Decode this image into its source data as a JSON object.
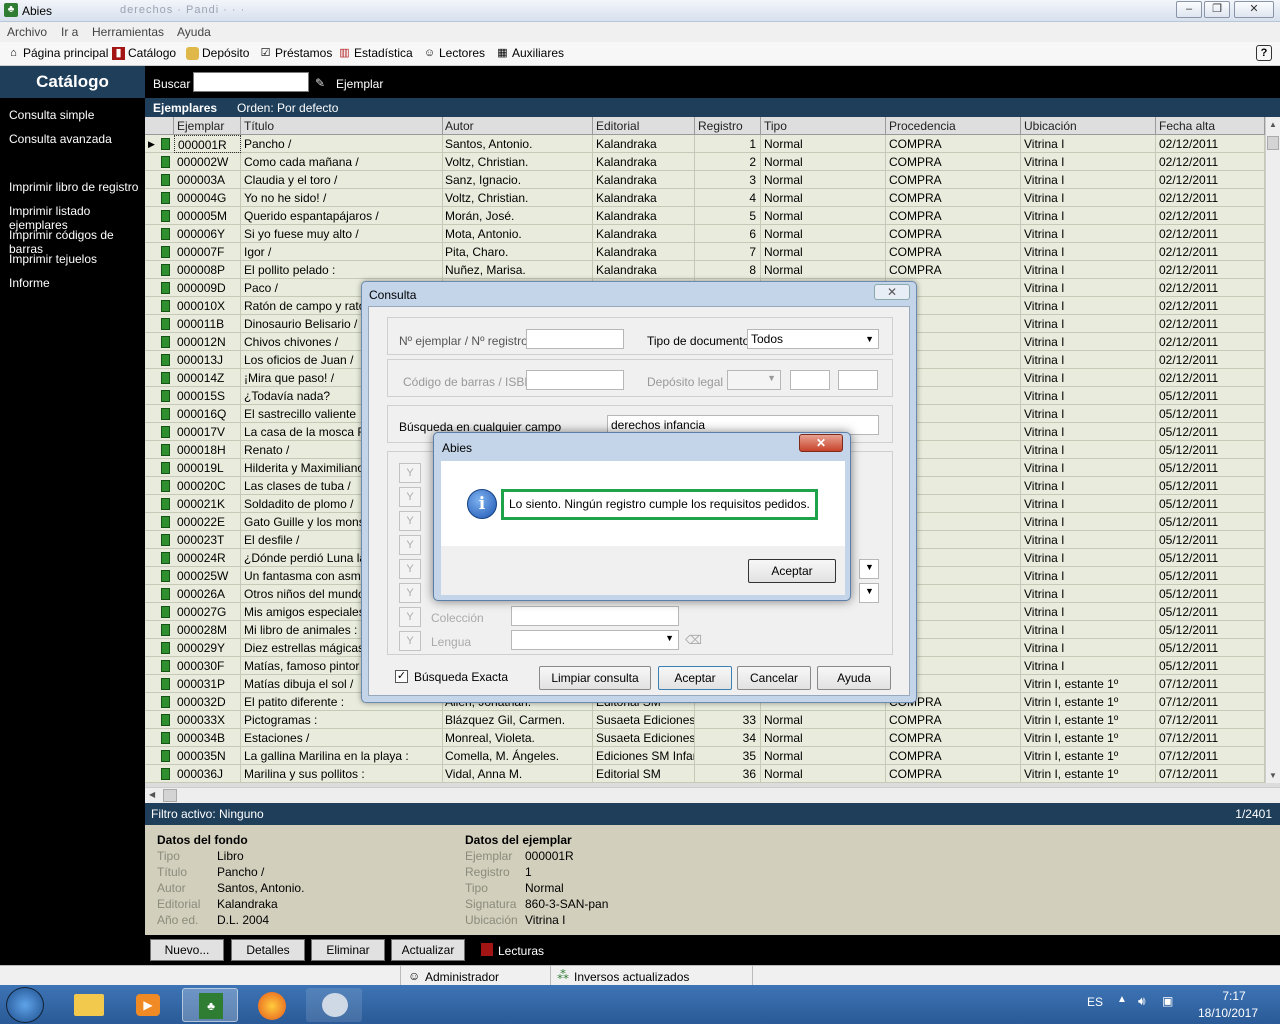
{
  "window": {
    "title": "Abies",
    "title_faded": "derechos · Pandi · · ·"
  },
  "menu": [
    "Archivo",
    "Ir a",
    "Herramientas",
    "Ayuda"
  ],
  "toolbar": [
    {
      "label": "Página principal",
      "icon": "home-icon"
    },
    {
      "label": "Catálogo",
      "icon": "book-icon"
    },
    {
      "label": "Depósito",
      "icon": "drawer-icon"
    },
    {
      "label": "Préstamos",
      "icon": "checkmark-icon"
    },
    {
      "label": "Estadística",
      "icon": "bar-chart-icon"
    },
    {
      "label": "Lectores",
      "icon": "user-icon"
    },
    {
      "label": "Auxiliares",
      "icon": "table-icon"
    }
  ],
  "sidebar": {
    "title": "Catálogo",
    "items": [
      "Consulta simple",
      "Consulta avanzada",
      "Imprimir libro de registro",
      "Imprimir listado ejemplares",
      "Imprimir códigos de barras",
      "Imprimir tejuelos",
      "Informe"
    ]
  },
  "search": {
    "label": "Buscar",
    "value": "",
    "mode": "Ejemplar"
  },
  "list": {
    "title": "Ejemplares",
    "order": "Orden: Por defecto"
  },
  "columns": [
    "Ejemplar",
    "Título",
    "Autor",
    "Editorial",
    "Registro",
    "Tipo",
    "Procedencia",
    "Ubicación",
    "Fecha alta"
  ],
  "rows": [
    [
      "000001R",
      "Pancho /",
      "Santos, Antonio.",
      "Kalandraka",
      "1",
      "Normal",
      "COMPRA",
      "Vitrina I",
      "02/12/2011"
    ],
    [
      "000002W",
      "Como cada mañana /",
      "Voltz, Christian.",
      "Kalandraka",
      "2",
      "Normal",
      "COMPRA",
      "Vitrina I",
      "02/12/2011"
    ],
    [
      "000003A",
      "Claudia y el toro /",
      "Sanz, Ignacio.",
      "Kalandraka",
      "3",
      "Normal",
      "COMPRA",
      "Vitrina I",
      "02/12/2011"
    ],
    [
      "000004G",
      "Yo no he sido! /",
      "Voltz, Christian.",
      "Kalandraka",
      "4",
      "Normal",
      "COMPRA",
      "Vitrina I",
      "02/12/2011"
    ],
    [
      "000005M",
      "Querido espantapájaros /",
      "Morán, José.",
      "Kalandraka",
      "5",
      "Normal",
      "COMPRA",
      "Vitrina I",
      "02/12/2011"
    ],
    [
      "000006Y",
      "Si yo fuese muy alto /",
      "Mota, Antonio.",
      "Kalandraka",
      "6",
      "Normal",
      "COMPRA",
      "Vitrina I",
      "02/12/2011"
    ],
    [
      "000007F",
      "Igor /",
      "Pita, Charo.",
      "Kalandraka",
      "7",
      "Normal",
      "COMPRA",
      "Vitrina I",
      "02/12/2011"
    ],
    [
      "000008P",
      "El pollito pelado :",
      "Nuñez, Marisa.",
      "Kalandraka",
      "8",
      "Normal",
      "COMPRA",
      "Vitrina I",
      "02/12/2011"
    ],
    [
      "000009D",
      "Paco /",
      "",
      "",
      "",
      "",
      "RA",
      "Vitrina I",
      "02/12/2011"
    ],
    [
      "000010X",
      "Ratón de campo y ratón",
      "",
      "",
      "",
      "",
      "RA",
      "Vitrina I",
      "02/12/2011"
    ],
    [
      "000011B",
      "Dinosaurio Belisario /",
      "",
      "",
      "",
      "",
      "RA",
      "Vitrina I",
      "02/12/2011"
    ],
    [
      "000012N",
      "Chivos chivones /",
      "",
      "",
      "",
      "",
      "RA",
      "Vitrina I",
      "02/12/2011"
    ],
    [
      "000013J",
      "Los oficios de Juan /",
      "",
      "",
      "",
      "",
      "RA",
      "Vitrina I",
      "02/12/2011"
    ],
    [
      "000014Z",
      "¡Mira que paso! /",
      "",
      "",
      "",
      "",
      "RA",
      "Vitrina I",
      "02/12/2011"
    ],
    [
      "000015S",
      "¿Todavía nada?",
      "",
      "",
      "",
      "",
      "RA",
      "Vitrina I",
      "05/12/2011"
    ],
    [
      "000016Q",
      "El sastrecillo valiente",
      "",
      "",
      "",
      "",
      "RA",
      "Vitrina I",
      "05/12/2011"
    ],
    [
      "000017V",
      "La casa de la mosca Fos",
      "",
      "",
      "",
      "",
      "RA",
      "Vitrina I",
      "05/12/2011"
    ],
    [
      "000018H",
      "Renato /",
      "",
      "",
      "",
      "",
      "RA",
      "Vitrina I",
      "05/12/2011"
    ],
    [
      "000019L",
      "Hilderita y Maximiliano /",
      "",
      "",
      "",
      "",
      "RA",
      "Vitrina I",
      "05/12/2011"
    ],
    [
      "000020C",
      "Las clases de tuba /",
      "",
      "",
      "",
      "",
      "RA",
      "Vitrina I",
      "05/12/2011"
    ],
    [
      "000021K",
      "Soldadito de plomo /",
      "",
      "",
      "",
      "",
      "RA",
      "Vitrina I",
      "05/12/2011"
    ],
    [
      "000022E",
      "Gato Guille y los monstru",
      "",
      "",
      "",
      "",
      "RA",
      "Vitrina I",
      "05/12/2011"
    ],
    [
      "000023T",
      "El desfile /",
      "",
      "",
      "",
      "",
      "RA",
      "Vitrina I",
      "05/12/2011"
    ],
    [
      "000024R",
      "¿Dónde perdió Luna la ri",
      "",
      "",
      "",
      "",
      "RA",
      "Vitrina I",
      "05/12/2011"
    ],
    [
      "000025W",
      "Un fantasma con asma /",
      "",
      "",
      "",
      "",
      "RA",
      "Vitrina I",
      "05/12/2011"
    ],
    [
      "000026A",
      "Otros niños del mundo /",
      "",
      "",
      "",
      "",
      "RA",
      "Vitrina I",
      "05/12/2011"
    ],
    [
      "000027G",
      "Mis amigos especiales /",
      "",
      "",
      "",
      "",
      "RA",
      "Vitrina I",
      "05/12/2011"
    ],
    [
      "000028M",
      "Mi libro de animales :",
      "",
      "",
      "",
      "",
      "RA",
      "Vitrina I",
      "05/12/2011"
    ],
    [
      "000029Y",
      "Diez estrellas mágicas /",
      "",
      "",
      "",
      "",
      "RA",
      "Vitrina I",
      "05/12/2011"
    ],
    [
      "000030F",
      "Matías, famoso pintor /",
      "",
      "",
      "",
      "",
      "RA",
      "Vitrina I",
      "05/12/2011"
    ],
    [
      "000031P",
      "Matías dibuja el sol /",
      "",
      "",
      "",
      "",
      "RA",
      "Vitrin I, estante 1º",
      "07/12/2011"
    ],
    [
      "000032D",
      "El patito diferente :",
      "Allen, Jonathan.",
      "Editorial SM",
      "",
      "",
      "COMPRA",
      "Vitrin I, estante 1º",
      "07/12/2011"
    ],
    [
      "000033X",
      "Pictogramas :",
      "Blázquez Gil, Carmen.",
      "Susaeta Ediciones, S",
      "33",
      "Normal",
      "COMPRA",
      "Vitrin I, estante 1º",
      "07/12/2011"
    ],
    [
      "000034B",
      "Estaciones /",
      "Monreal, Violeta.",
      "Susaeta Ediciones, S",
      "34",
      "Normal",
      "COMPRA",
      "Vitrin I, estante 1º",
      "07/12/2011"
    ],
    [
      "000035N",
      "La gallina Marilina en la playa :",
      "Comella, M. Ángeles.",
      "Ediciones SM Infanti",
      "35",
      "Normal",
      "COMPRA",
      "Vitrin I, estante 1º",
      "07/12/2011"
    ],
    [
      "000036J",
      "Marilina y sus pollitos :",
      "Vidal, Anna M.",
      "Editorial SM",
      "36",
      "Normal",
      "COMPRA",
      "Vitrin I, estante 1º",
      "07/12/2011"
    ]
  ],
  "filter": {
    "text": "Filtro activo: Ninguno",
    "count": "1/2401"
  },
  "fondo": {
    "title": "Datos del fondo",
    "fields": [
      [
        "Tipo",
        "Libro"
      ],
      [
        "Título",
        "Pancho /"
      ],
      [
        "Autor",
        "Santos, Antonio."
      ],
      [
        "Editorial",
        "Kalandraka"
      ],
      [
        "Año ed.",
        "D.L. 2004"
      ]
    ]
  },
  "ejemplar": {
    "title": "Datos del ejemplar",
    "fields": [
      [
        "Ejemplar",
        "000001R"
      ],
      [
        "Registro",
        "1"
      ],
      [
        "Tipo",
        "Normal"
      ],
      [
        "Signatura",
        "860-3-SAN-pan"
      ],
      [
        "Ubicación",
        "Vitrina I"
      ]
    ]
  },
  "buttons": {
    "nuevo": "Nuevo...",
    "detalles": "Detalles",
    "eliminar": "Eliminar",
    "actualizar": "Actualizar",
    "lecturas": "Lecturas"
  },
  "status": {
    "user": "Administrador",
    "inversos": "Inversos actualizados"
  },
  "consulta": {
    "title": "Consulta",
    "num_label": "Nº ejemplar / Nº registro",
    "tipo_doc_label": "Tipo de documento",
    "tipo_doc_value": "Todos",
    "barcode_label": "Código de barras / ISBN",
    "deposito_label": "Depósito legal",
    "any_label": "Búsqueda en cualquier campo",
    "any_value": "derechos infancia",
    "coleccion_label": "Colección",
    "lengua_label": "Lengua",
    "y": "Y",
    "exact_label": "Búsqueda Exacta",
    "limpiar": "Limpiar consulta",
    "aceptar": "Aceptar",
    "cancelar": "Cancelar",
    "ayuda": "Ayuda"
  },
  "alert": {
    "title": "Abies",
    "message": "Lo siento. Ningún registro cumple los requisitos pedidos.",
    "button": "Aceptar",
    "highlight": "#1fa34a"
  },
  "taskbar": {
    "lang": "ES",
    "time": "7:17",
    "date": "18/10/2017"
  }
}
